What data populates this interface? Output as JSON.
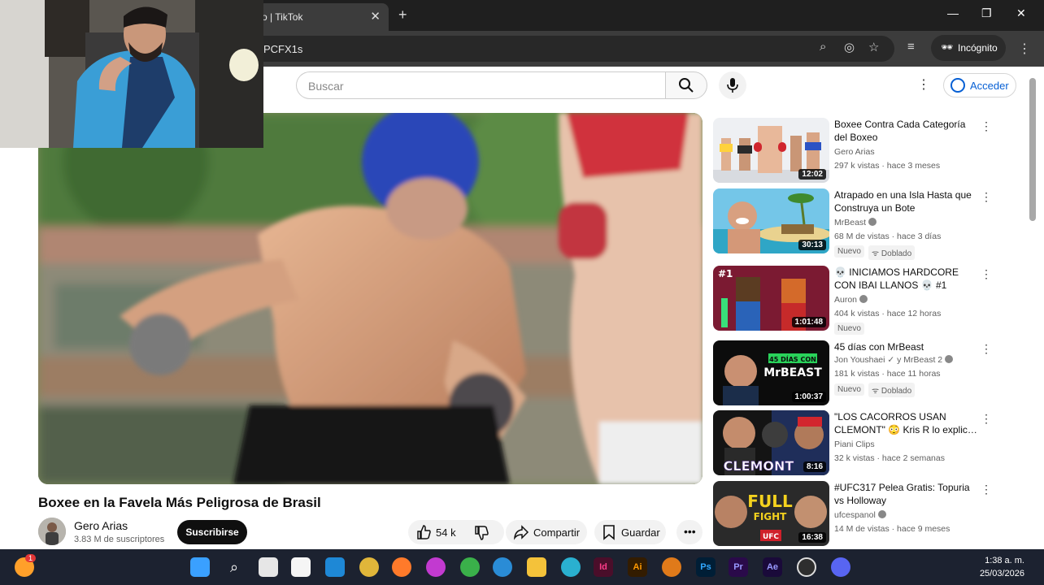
{
  "browser": {
    "tab_title": "o | TikTok",
    "url_fragment": "PCFX1s",
    "incognito_label": "Incógnito",
    "tab_close": "✕",
    "new_tab": "+",
    "minimize": "—",
    "maximize": "❐",
    "close": "✕"
  },
  "youtube": {
    "search_placeholder": "Buscar",
    "signin_label": "Acceder"
  },
  "video": {
    "title": "Boxee en la Favela Más Peligrosa de Brasil",
    "channel": "Gero Arias",
    "subscribers": "3.83 M de suscriptores",
    "subscribe_label": "Suscribirse",
    "likes": "54 k",
    "share_label": "Compartir",
    "save_label": "Guardar"
  },
  "recommendations": [
    {
      "title": "Boxee Contra Cada Categoría del Boxeo",
      "channel": "Gero Arias",
      "meta": "297 k vistas · hace 3 meses",
      "duration": "12:02",
      "badges": [],
      "verified": false
    },
    {
      "title": "Atrapado en una Isla Hasta que Construya un Bote",
      "channel": "MrBeast",
      "meta": "68 M de vistas · hace 3 días",
      "duration": "30:13",
      "badges": [
        "Nuevo",
        "Doblado"
      ],
      "verified": true
    },
    {
      "title": "💀 INICIAMOS HARDCORE CON IBAI LLANOS 💀 #1",
      "channel": "Auron",
      "meta": "404 k vistas · hace 12 horas",
      "duration": "1:01:48",
      "badges": [
        "Nuevo"
      ],
      "verified": true
    },
    {
      "title": "45 días con MrBeast",
      "channel": "Jon Youshaei ✓ y MrBeast 2",
      "meta": "181 k vistas · hace 11 horas",
      "duration": "1:00:37",
      "badges": [
        "Nuevo",
        "Doblado"
      ],
      "verified": true
    },
    {
      "title": "\"LOS CACORROS USAN CLEMONT\" 😳 Kris R lo explic…",
      "channel": "Piani Clips",
      "meta": "32 k vistas · hace 2 semanas",
      "duration": "8:16",
      "badges": [],
      "verified": false
    },
    {
      "title": "#UFC317 Pelea Gratis: Topuria vs Holloway",
      "channel": "ufcespanol",
      "meta": "14 M de vistas · hace 9 meses",
      "duration": "16:38",
      "badges": [],
      "verified": true
    }
  ],
  "thumb_text": {
    "r3_hash": "#1",
    "r4_line1": "45 DÍAS CON",
    "r4_line2": "MrBEAST",
    "r5_name": "CLEMONT",
    "r6_line1": "FULL",
    "r6_line2": "FIGHT",
    "r6_brand": "UFC"
  },
  "taskbar": {
    "time": "1:38 a. m.",
    "date": "25/03/2026",
    "notification_count": "1"
  }
}
